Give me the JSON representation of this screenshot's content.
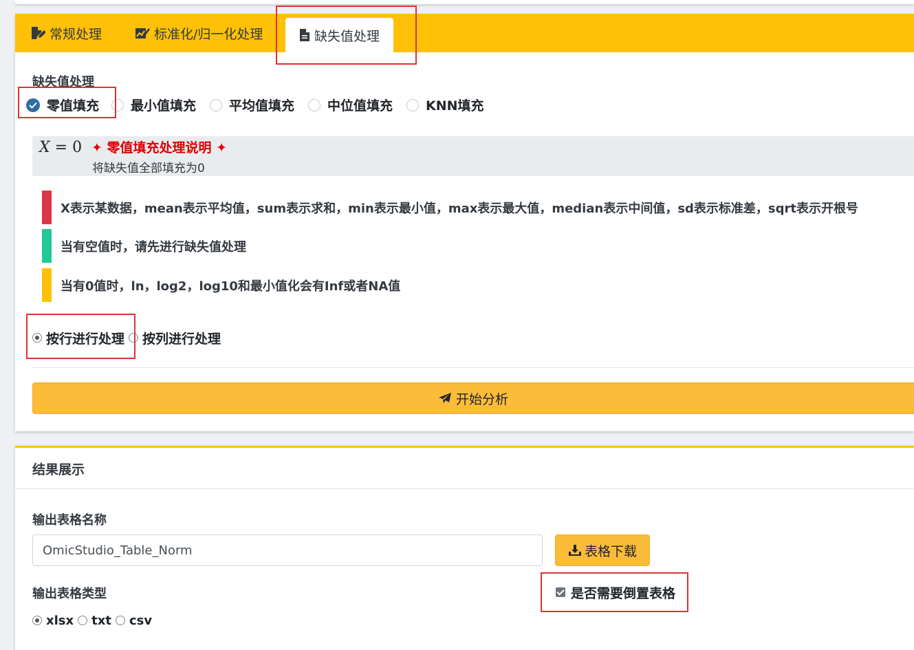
{
  "tabs": [
    {
      "label": "常规处理",
      "icon": "file-edit-icon"
    },
    {
      "label": "标准化/归一化处理",
      "icon": "chart-edit-icon"
    },
    {
      "label": "缺失值处理",
      "icon": "document-icon",
      "active": true
    }
  ],
  "missing": {
    "section_label": "缺失值处理",
    "options": [
      "零值填充",
      "最小值填充",
      "平均值填充",
      "中位值填充",
      "KNN填充"
    ],
    "selected": "零值填充"
  },
  "formula": {
    "expr_var": "X",
    "expr_rest": " = 0",
    "title": "✦ 零值填充处理说明 ✦",
    "desc": "将缺失值全部填充为0"
  },
  "notes": [
    {
      "text": "X表示某数据，mean表示平均值，sum表示求和，min表示最小值，max表示最大值，median表示中间值，sd表示标准差，sqrt表示开根号",
      "color": "#dc3545"
    },
    {
      "text": "当有空值时，请先进行缺失值处理",
      "color": "#20c997"
    },
    {
      "text": "当有0值时，ln，log2，log10和最小值化会有Inf或者NA值",
      "color": "#ffc107"
    }
  ],
  "direction": {
    "options": [
      "按行进行处理",
      "按列进行处理"
    ],
    "selected": "按行进行处理"
  },
  "analyze_button": "开始分析",
  "result": {
    "header": "结果展示",
    "output_name_label": "输出表格名称",
    "output_name_value": "OmicStudio_Table_Norm",
    "download_button": "表格下载",
    "output_type_label": "输出表格类型",
    "types": [
      "xlsx",
      "txt",
      "csv"
    ],
    "selected_type": "xlsx",
    "transpose_label": "是否需要倒置表格",
    "transpose_checked": true
  },
  "colors": {
    "accent": "#ffc107",
    "button": "#fbbc3a",
    "highlight": "#e03131",
    "title_red": "#e00000"
  }
}
